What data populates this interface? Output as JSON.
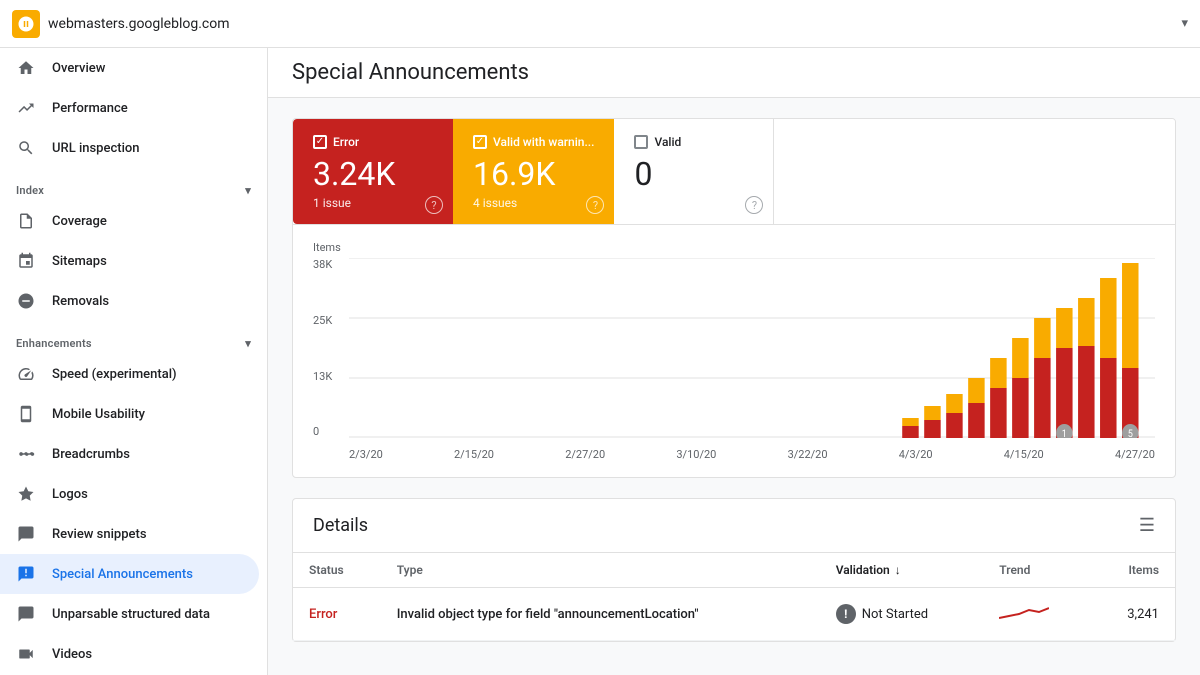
{
  "topbar": {
    "domain": "webmasters.googleblog.com",
    "logo_color": "#f9ab00"
  },
  "sidebar": {
    "nav_items": [
      {
        "id": "overview",
        "label": "Overview",
        "icon": "home"
      },
      {
        "id": "performance",
        "label": "Performance",
        "icon": "trending-up"
      },
      {
        "id": "url-inspection",
        "label": "URL inspection",
        "icon": "search"
      }
    ],
    "index_section": "Index",
    "index_items": [
      {
        "id": "coverage",
        "label": "Coverage",
        "icon": "file"
      },
      {
        "id": "sitemaps",
        "label": "Sitemaps",
        "icon": "sitemap"
      },
      {
        "id": "removals",
        "label": "Removals",
        "icon": "remove-circle"
      }
    ],
    "enhancements_section": "Enhancements",
    "enhancements_items": [
      {
        "id": "speed",
        "label": "Speed (experimental)",
        "icon": "speed"
      },
      {
        "id": "mobile-usability",
        "label": "Mobile Usability",
        "icon": "mobile"
      },
      {
        "id": "breadcrumbs",
        "label": "Breadcrumbs",
        "icon": "breadcrumb"
      },
      {
        "id": "logos",
        "label": "Logos",
        "icon": "logo"
      },
      {
        "id": "review-snippets",
        "label": "Review snippets",
        "icon": "review"
      },
      {
        "id": "special-announcements",
        "label": "Special Announcements",
        "icon": "announcement",
        "active": true
      },
      {
        "id": "unparsable",
        "label": "Unparsable structured data",
        "icon": "unparsable"
      },
      {
        "id": "videos",
        "label": "Videos",
        "icon": "video"
      }
    ]
  },
  "page": {
    "title": "Special Announcements"
  },
  "status_cards": {
    "error": {
      "label": "Error",
      "count": "3.24K",
      "issues": "1 issue",
      "checked": true
    },
    "warning": {
      "label": "Valid with warnin...",
      "count": "16.9K",
      "issues": "4 issues",
      "checked": true
    },
    "valid": {
      "label": "Valid",
      "count": "0",
      "checked": false
    }
  },
  "chart": {
    "y_label": "Items",
    "y_ticks": [
      "38K",
      "25K",
      "13K",
      "0"
    ],
    "x_ticks": [
      "2/3/20",
      "2/15/20",
      "2/27/20",
      "3/10/20",
      "3/22/20",
      "4/3/20",
      "4/15/20",
      "4/27/20"
    ],
    "annotations": [
      {
        "id": "1",
        "x_index": 6
      },
      {
        "id": "5",
        "x_index": 7
      }
    ]
  },
  "details": {
    "title": "Details",
    "columns": {
      "status": "Status",
      "type": "Type",
      "validation": "Validation",
      "trend": "Trend",
      "items": "Items"
    },
    "rows": [
      {
        "status": "Error",
        "type": "Invalid object type for field \"announcementLocation\"",
        "validation": "Not Started",
        "trend_direction": "up",
        "items": "3,241"
      }
    ]
  },
  "filter_icon": "≡",
  "sort_down_icon": "↓"
}
